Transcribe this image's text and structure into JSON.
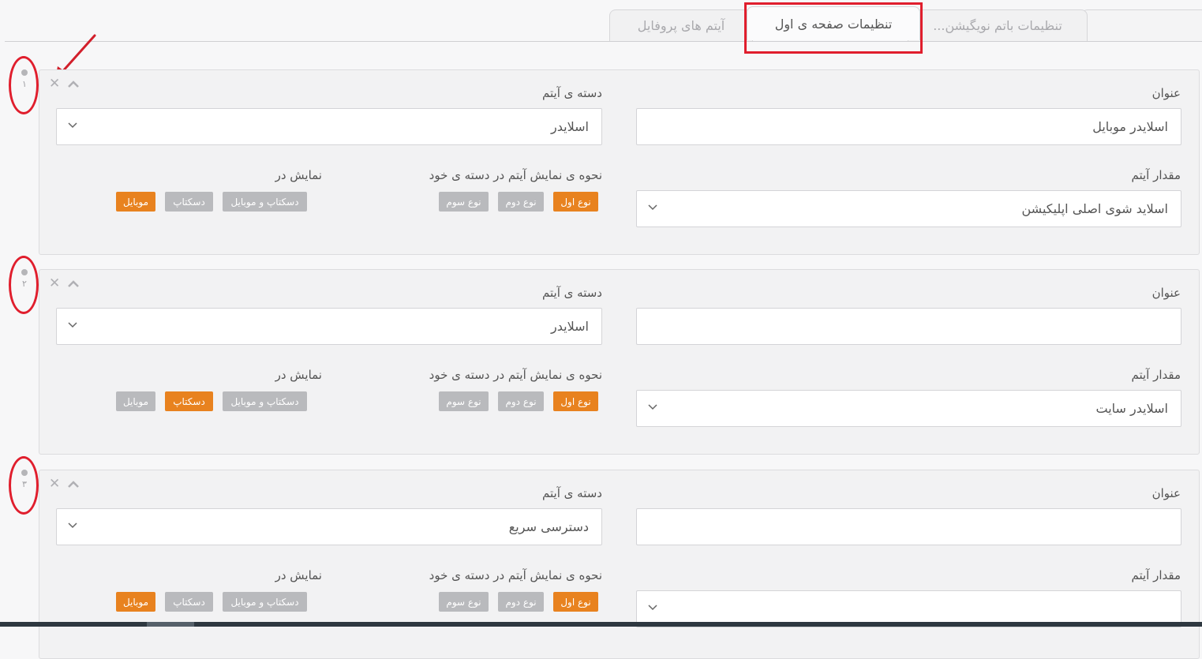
{
  "tabs": [
    {
      "label": "تنظیمات باتم نویگیشن..."
    },
    {
      "label": "تنظیمات صفحه ی اول"
    },
    {
      "label": "آیتم های پروفایل"
    }
  ],
  "labels": {
    "title": "عنوان",
    "category": "دسته ی آیتم",
    "value": "مقدار آیتم",
    "display_mode": "نحوه ی نمایش آیتم در دسته ی خود",
    "show_in": "نمایش در"
  },
  "mode_options": [
    "نوع اول",
    "نوع دوم",
    "نوع سوم"
  ],
  "show_options": [
    "موبایل",
    "دسکتاپ",
    "دسکتاپ و موبایل"
  ],
  "items": [
    {
      "number": "۱",
      "title": "اسلایدر موبایل",
      "category": "اسلایدر",
      "value": "اسلاید شوی اصلی اپلیکیشن",
      "mode_selected": "نوع اول",
      "show_selected": "موبایل"
    },
    {
      "number": "۲",
      "title": "",
      "category": "اسلایدر",
      "value": "اسلایدر سایت",
      "mode_selected": "نوع اول",
      "show_selected": "دسکتاپ"
    },
    {
      "number": "۳",
      "title": "",
      "category": "دسترسی سریع",
      "value": "",
      "mode_selected": "نوع اول",
      "show_selected": "موبایل"
    }
  ],
  "icons": {
    "remove": "close-icon",
    "collapse": "chevron-up-icon",
    "dropdown": "chevron-down-icon"
  },
  "colors": {
    "accent": "#e8821f",
    "inactive_button": "#b9babd",
    "annotation": "#e01e2d"
  }
}
